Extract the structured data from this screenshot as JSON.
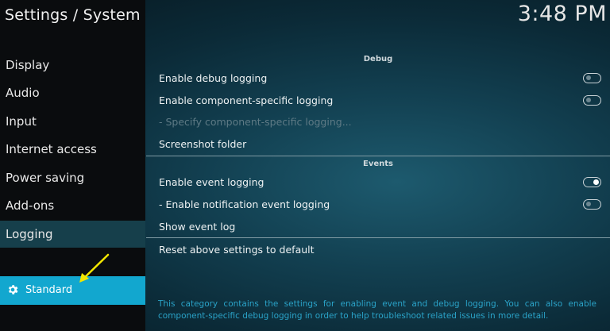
{
  "window": {
    "title": "Settings / System"
  },
  "clock": {
    "time": "3:48 PM"
  },
  "sidebar": {
    "items": [
      {
        "label": "Display",
        "selected": false
      },
      {
        "label": "Audio",
        "selected": false
      },
      {
        "label": "Input",
        "selected": false
      },
      {
        "label": "Internet access",
        "selected": false
      },
      {
        "label": "Power saving",
        "selected": false
      },
      {
        "label": "Add-ons",
        "selected": false
      },
      {
        "label": "Logging",
        "selected": true
      }
    ],
    "level_button": {
      "label": "Standard",
      "icon": "gear-icon"
    }
  },
  "sections": {
    "debug": {
      "header": "Debug",
      "settings": [
        {
          "label": "Enable debug logging",
          "toggle": "off"
        },
        {
          "label": "Enable component-specific logging",
          "toggle": "off"
        },
        {
          "label": "- Specify component-specific logging...",
          "disabled": true
        },
        {
          "label": "Screenshot folder"
        }
      ]
    },
    "events": {
      "header": "Events",
      "settings": [
        {
          "label": "Enable event logging",
          "toggle": "on"
        },
        {
          "label": "- Enable notification event logging",
          "toggle": "off"
        },
        {
          "label": "Show event log"
        }
      ]
    },
    "reset": {
      "label": "Reset above settings to default"
    }
  },
  "description": "This category contains the settings for enabling event and debug logging. You can also enable component-specific debug logging in order to help troubleshoot related issues in more detail.",
  "colors": {
    "accent": "#12a7cf",
    "sidebar_bg": "#0a0c0e",
    "selected_item_bg": "#163f4b",
    "description_text": "#2aa3c8",
    "annotation_arrow": "#f2e600"
  }
}
